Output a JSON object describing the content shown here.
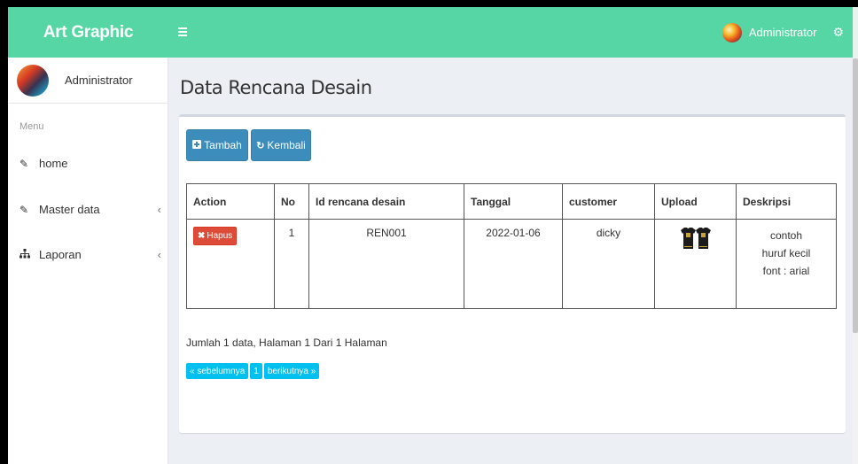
{
  "app": {
    "brand": "Art Graphic"
  },
  "topbar": {
    "user": "Administrator",
    "gear_icon": "gear-icon",
    "menu_icon": "hamburger-icon"
  },
  "sidebar": {
    "user_name": "Administrator",
    "menu_header": "Menu",
    "items": [
      {
        "label": "home",
        "icon": "edit-icon",
        "has_chevron": false
      },
      {
        "label": "Master data",
        "icon": "edit-icon",
        "has_chevron": true
      },
      {
        "label": "Laporan",
        "icon": "sitemap-icon",
        "has_chevron": true
      }
    ]
  },
  "main": {
    "title": "Data Rencana Desain",
    "buttons": {
      "tambah": "Tambah",
      "kembali": "Kembali"
    },
    "table": {
      "headers": [
        "Action",
        "No",
        "Id rencana desain",
        "Tanggal",
        "customer",
        "Upload",
        "Deskripsi"
      ],
      "rows": [
        {
          "action": "Hapus",
          "no": "1",
          "id": "REN001",
          "tanggal": "2022-01-06",
          "customer": "dicky",
          "upload": "tshirt-image",
          "deskripsi": [
            "contoh",
            "huruf kecil",
            "font : arial"
          ]
        }
      ]
    },
    "summary": "Jumlah 1 data, Halaman 1 Dari 1 Halaman",
    "pagination": {
      "prev": "« sebelumnya",
      "page": "1",
      "next": "berikutnya »"
    }
  },
  "colors": {
    "header": "#55d6a4",
    "primary": "#3c8dbc",
    "danger": "#dd4b39",
    "info": "#00c0ef"
  }
}
